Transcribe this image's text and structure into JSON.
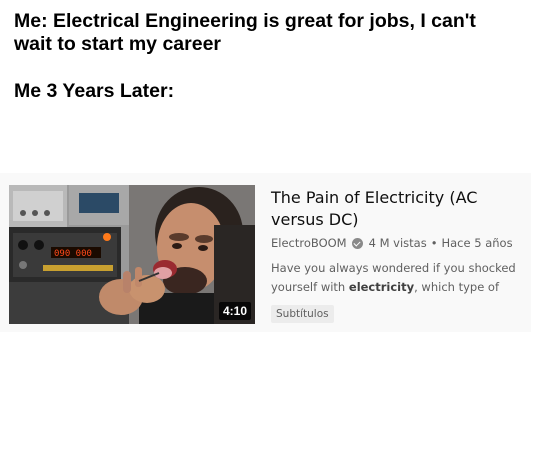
{
  "caption": {
    "line1": "Me: Electrical Engineering is great for jobs, I can't wait to start my career",
    "line2": "Me 3 Years Later:"
  },
  "video": {
    "title": "The Pain of Electricity (AC versus DC)",
    "channel": "ElectroBOOM",
    "views": "4 M vistas",
    "separator": "•",
    "age": "Hace 5 años",
    "description_before": "Have you always wondered if you shocked yourself with ",
    "description_bold": "electricity",
    "description_after": ", which type of",
    "badge": "Subtítulos",
    "duration": "4:10",
    "display_readout": "090 000"
  }
}
